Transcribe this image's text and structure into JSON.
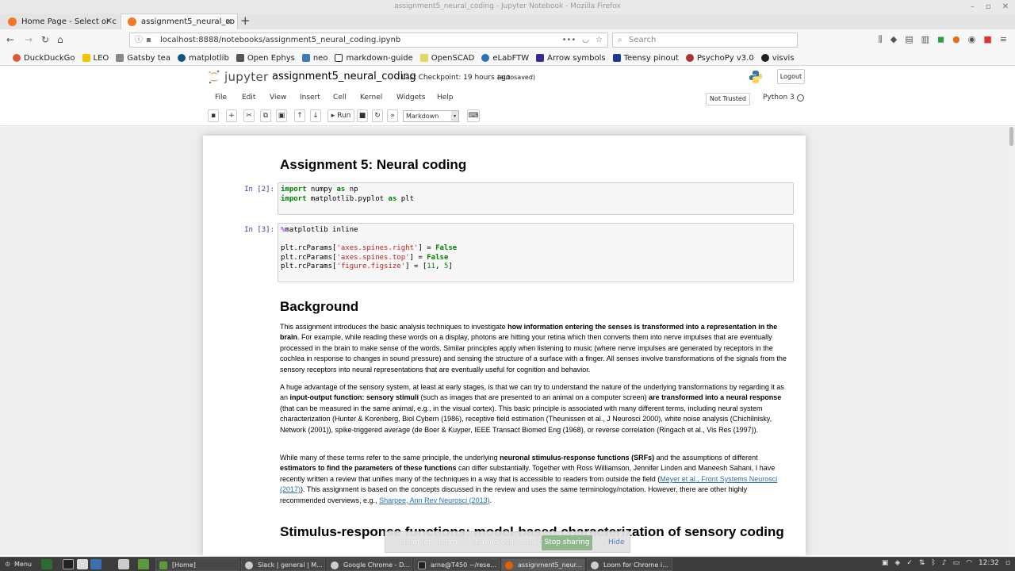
{
  "window": {
    "title": "assignment5_neural_coding - Jupyter Notebook - Mozilla Firefox"
  },
  "tabs": [
    {
      "label": "Home Page - Select or c"
    },
    {
      "label": "assignment5_neural_co"
    }
  ],
  "nav": {
    "url": "localhost:8888/notebooks/assignment5_neural_coding.ipynb",
    "search_placeholder": "Search"
  },
  "bookmarks": [
    "DuckDuckGo",
    "LEO",
    "Gatsby tea",
    "matplotlib",
    "Open Ephys",
    "neo",
    "markdown-guide",
    "OpenSCAD",
    "eLabFTW",
    "Arrow symbols",
    "Teensy pinout",
    "PsychoPy v3.0",
    "visvis"
  ],
  "jupyter": {
    "logo_text": "jupyter",
    "notebook_name": "assignment5_neural_coding",
    "checkpoint": "Last Checkpoint: 19 hours ago",
    "autosaved": "(autosaved)",
    "logout": "Logout",
    "menu": [
      "File",
      "Edit",
      "View",
      "Insert",
      "Cell",
      "Kernel",
      "Widgets",
      "Help"
    ],
    "trust": "Not Trusted",
    "kernel": "Python 3",
    "run_label": "Run",
    "cell_type": "Markdown"
  },
  "cells": {
    "title": "Assignment 5: Neural coding",
    "prompt1": "In [2]:",
    "prompt2": "In [3]:",
    "background_heading": "Background",
    "next_heading": "Stimulus-response functions: model-based characterization of sensory coding"
  },
  "paragraphs": {
    "p1a": "This assignment introduces the basic analysis techniques to investigate ",
    "p1b": "how information entering the senses is transformed into a representation in the brain",
    "p1c": ". For example, while reading these words on a display, photons are hitting your retina which then converts them into nerve impulses that are eventually processed in the brain to make sense of the words. Similar principles apply when listening to music (where nerve impulses are generated by receptors in the cochlea in response to changes in sound pressure) and sensing the structure of a surface with a finger. All senses involve transformations of the signals from the sensory receptors into neural representations that are eventually useful for cognition and behavior.",
    "p2a": "A huge advantage of the sensory system, at least at early stages, is that we can try to understand the nature of the underlying transformations by regarding it as an ",
    "p2b": "input-output function: sensory stimuli",
    "p2c": " (such as images that are presented to an animal on a computer screen) ",
    "p2d": "are transformed into a neural response",
    "p2e": " (that can be measured in the same animal, e.g., in the visual cortex). This basic principle is associated with many different terms, including neural system characterization (Hunter & Korenberg, Biol Cybern (1986), receptive field estimation (Theunissen et al., J Neurosci 2000), white noise analysis (Chichilnisky, Network (2001)), spike-triggered average (de Boer & Kuyper, IEEE Transact Biomed Eng (1968), or reverse correlation (Ringach et al., Vis Res (1997)).",
    "p3a": "While many of these terms refer to the same principle, the underlying ",
    "p3b": "neuronal stimulus-response functions (SRFs)",
    "p3c": " and the assumptions of different ",
    "p3d": "estimators to find the parameters of these functions",
    "p3e": " can differ substantially. Together with Ross Williamson, Jennifer Linden and Maneesh Sahani, I have recently written a review that unifies many of the techniques in a way that is accessible to readers from outside the field (",
    "p3f": "Meyer et al., Front Systems Neurosci (2017)",
    "p3g": "). This assignment is based on the concepts discussed in the review and uses the same terminology/notation. However, there are other highly recommended overviews, e.g., ",
    "p3h": "Sharpee, Ann Rev Neurosci (2013)",
    "p3i": "."
  },
  "loom": {
    "message": "Loom for Chrome is sharing your screen.",
    "stop": "Stop sharing",
    "hide": "Hide"
  },
  "taskbar": {
    "menu": "Menu",
    "windows": [
      "[Home]",
      "Slack | general | M...",
      "Google Chrome - D...",
      "arne@T450 ~/rese...",
      "assignment5_neur...",
      "Loom for Chrome i..."
    ],
    "clock": "12:32"
  },
  "colors": {
    "jupyter_orange": "#f37726",
    "prompt_blue": "#303f9f",
    "keyword_green": "#008000",
    "string_red": "#ba2121",
    "link_blue": "#296eaa"
  }
}
